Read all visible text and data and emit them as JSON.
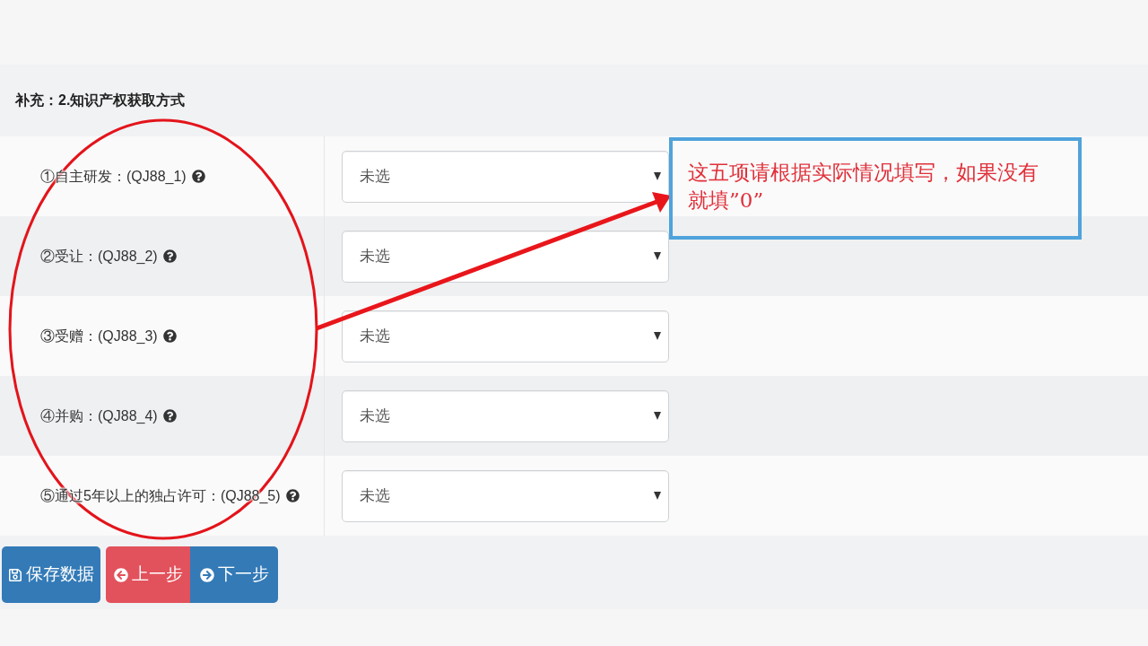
{
  "section_title": "补充：2.知识产权获取方式",
  "fields": [
    {
      "label": "①自主研发：(QJ88_1)",
      "value": "未选"
    },
    {
      "label": "②受让：(QJ88_2)",
      "value": "未选"
    },
    {
      "label": "③受赠：(QJ88_3)",
      "value": "未选"
    },
    {
      "label": "④并购：(QJ88_4)",
      "value": "未选"
    },
    {
      "label": "⑤通过5年以上的独占许可：(QJ88_5)",
      "value": "未选"
    }
  ],
  "buttons": [
    {
      "label": "保存数据",
      "kind": "save"
    },
    {
      "label": "上一步",
      "kind": "prev"
    },
    {
      "label": "下一步",
      "kind": "next"
    }
  ],
  "annotation": {
    "text": "这五项请根据实际情况填写，如果没有就填”0”"
  }
}
